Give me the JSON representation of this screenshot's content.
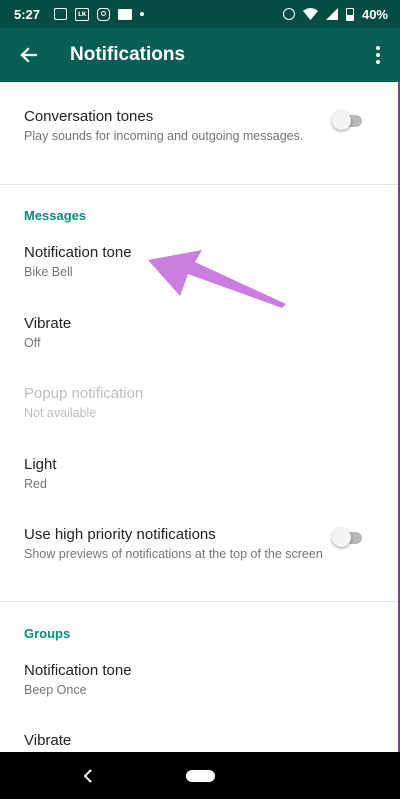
{
  "status_bar": {
    "time": "5:27",
    "battery": "40%",
    "icons_left": [
      "gallery-icon",
      "lk-app-icon",
      "instagram-icon",
      "mail-icon",
      "dot-icon"
    ],
    "icons_right": [
      "alarm-icon",
      "wifi-icon",
      "signal-icon",
      "battery-icon"
    ]
  },
  "app_bar": {
    "title": "Notifications",
    "bg_color": "#075e54"
  },
  "conversation_tones": {
    "title": "Conversation tones",
    "subtitle": "Play sounds for incoming and outgoing messages.",
    "enabled": false
  },
  "messages_section": {
    "header": "Messages",
    "notification_tone": {
      "title": "Notification tone",
      "value": "Bike Bell"
    },
    "vibrate": {
      "title": "Vibrate",
      "value": "Off"
    },
    "popup": {
      "title": "Popup notification",
      "value": "Not available"
    },
    "light": {
      "title": "Light",
      "value": "Red"
    },
    "high_priority": {
      "title": "Use high priority notifications",
      "subtitle": "Show previews of notifications at the top of the screen",
      "enabled": false
    }
  },
  "groups_section": {
    "header": "Groups",
    "notification_tone": {
      "title": "Notification tone",
      "value": "Beep Once"
    },
    "vibrate": {
      "title": "Vibrate"
    }
  },
  "colors": {
    "accent": "#0a8a7a",
    "annotation_arrow": "#cc7ee0"
  }
}
